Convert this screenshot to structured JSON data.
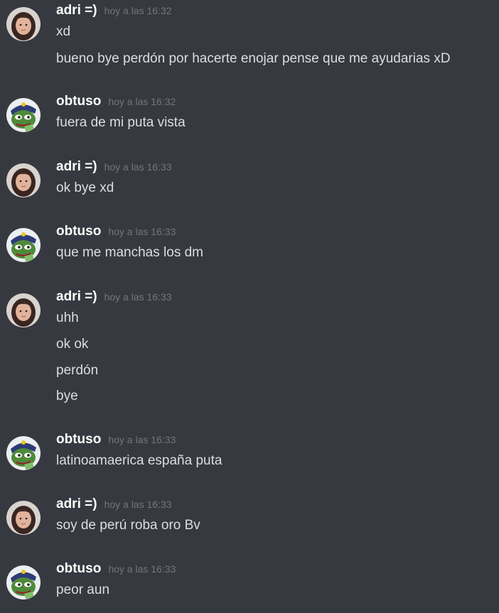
{
  "messages": [
    {
      "author": "adri =)",
      "time": "hoy a las 16:32",
      "avatar": "girl-avatar",
      "lines": [
        "xd",
        "bueno bye perdón por hacerte enojar pense que me ayudarias xD"
      ]
    },
    {
      "author": "obtuso",
      "time": "hoy a las 16:32",
      "avatar": "pepe-frog-avatar",
      "lines": [
        "fuera de mi puta vista"
      ]
    },
    {
      "author": "adri =)",
      "time": "hoy a las 16:33",
      "avatar": "girl-avatar",
      "lines": [
        "ok bye xd"
      ]
    },
    {
      "author": "obtuso",
      "time": "hoy a las 16:33",
      "avatar": "pepe-frog-avatar",
      "lines": [
        "que me manchas los dm"
      ]
    },
    {
      "author": "adri =)",
      "time": "hoy a las 16:33",
      "avatar": "girl-avatar",
      "lines": [
        "uhh",
        "ok ok",
        "perdón",
        "bye"
      ]
    },
    {
      "author": "obtuso",
      "time": "hoy a las 16:33",
      "avatar": "pepe-frog-avatar",
      "lines": [
        "latinoamaerica españa puta"
      ]
    },
    {
      "author": "adri =)",
      "time": "hoy a las 16:33",
      "avatar": "girl-avatar",
      "lines": [
        "soy de perú roba oro Bv"
      ]
    },
    {
      "author": "obtuso",
      "time": "hoy a las 16:33",
      "avatar": "pepe-frog-avatar",
      "lines": [
        "peor aun"
      ]
    }
  ],
  "colors": {
    "background": "#36393f",
    "username": "#ffffff",
    "timestamp": "#72767d",
    "text": "#dcddde"
  }
}
